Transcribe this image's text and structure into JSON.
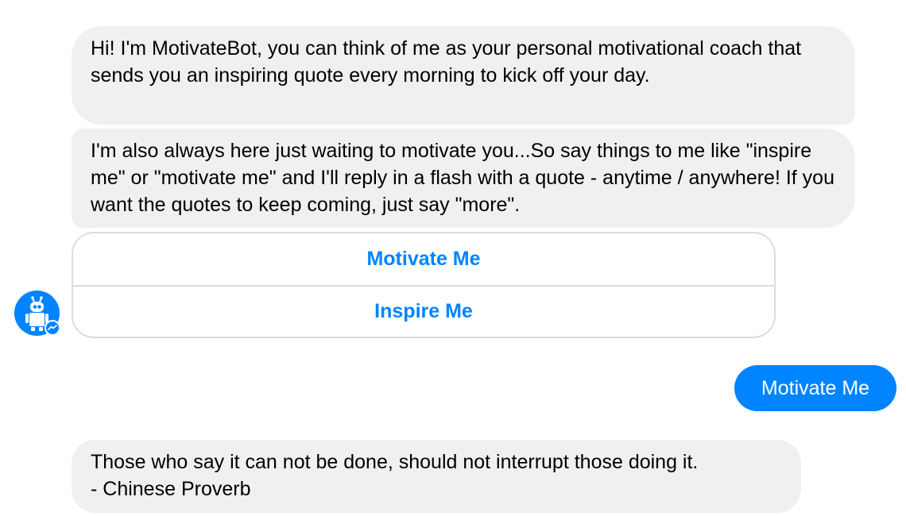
{
  "messages": {
    "bot_intro": "Hi! I'm MotivateBot, you can think of me as your personal motivational coach that sends you an inspiring quote every morning to kick off your day.",
    "bot_instructions": "I'm also always here just waiting to motivate you...So say things to me like \"inspire me\" or \"motivate me\" and I'll reply in a flash with a quote - anytime / anywhere! If you want the quotes to keep coming, just say \"more\".",
    "bot_quote_line1": "Those who say it can not be done, should not interrupt those doing it.",
    "bot_quote_line2": "- Chinese Proverb",
    "user_reply": "Motivate Me"
  },
  "quick_replies": [
    {
      "label": "Motivate Me"
    },
    {
      "label": "Inspire Me"
    }
  ],
  "avatar": {
    "icon": "robot-icon",
    "badge_icon": "messenger-badge-icon"
  },
  "colors": {
    "accent": "#0084ff",
    "bot_bubble": "#f1f0f0",
    "text": "#000000",
    "border": "#dcdcdc"
  }
}
